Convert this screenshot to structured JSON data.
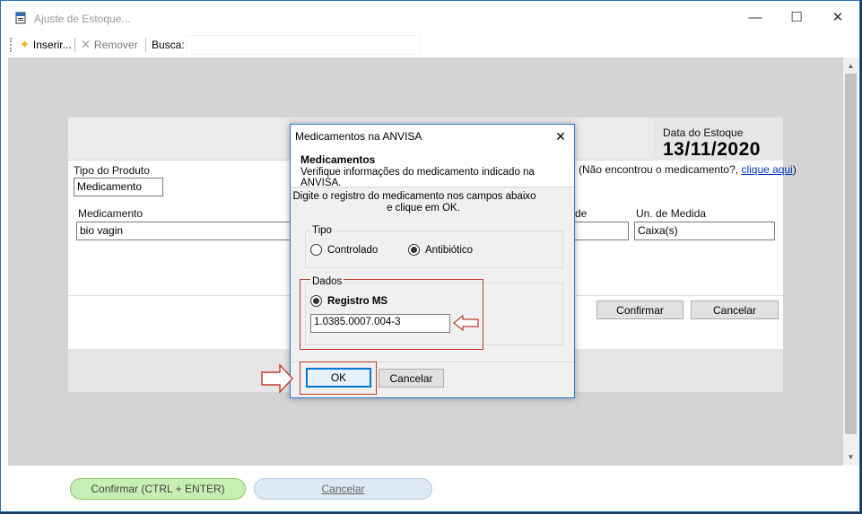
{
  "window": {
    "title": "Ajuste de Estoque...",
    "minimize_glyph": "—",
    "maximize_glyph": "☐",
    "close_glyph": "✕"
  },
  "toolbar": {
    "insert_label": "Inserir...",
    "remove_label": "Remover",
    "search_label": "Busca:",
    "search_value": ""
  },
  "form": {
    "date_label": "Data do Estoque",
    "date_value": "13/11/2020",
    "product_type_label": "Tipo do Produto",
    "product_type_value": "Medicamento",
    "not_found_text": "(Não encontrou o medicamento?, ",
    "not_found_link": "clique aqui",
    "not_found_close": ")",
    "medication_label": "Medicamento",
    "medication_value": "bio vagin",
    "quantity_label_partial": "de",
    "quantity_value": "",
    "unit_label": "Un. de Medida",
    "unit_value": "Caixa(s)",
    "confirm_label": "Confirmar",
    "cancel_label": "Cancelar"
  },
  "dialog": {
    "title": "Medicamentos na ANVISA",
    "close_glyph": "✕",
    "header_title": "Medicamentos",
    "header_subtitle": "Verifique informações do medicamento indicado na ANVISA.",
    "instruction_line1": "Digite o registro do medicamento nos campos abaixo",
    "instruction_line2": "e clique em OK.",
    "type_group_label": "Tipo",
    "type_options": [
      {
        "label": "Controlado",
        "selected": false
      },
      {
        "label": "Antibiótico",
        "selected": true
      }
    ],
    "data_group_label": "Dados",
    "registry_label": "Registro MS",
    "registry_value": "1.0385.0007.004-3",
    "ok_label": "OK",
    "cancel_label": "Cancelar"
  },
  "bottom": {
    "confirm_label": "Confirmar (CTRL + ENTER)",
    "cancel_label": "Cancelar"
  },
  "colors": {
    "annotation_red": "#c0392b",
    "confirm_green": "#c6efb3",
    "cancel_blue": "#dde8f5",
    "window_border": "#2d6db5"
  }
}
